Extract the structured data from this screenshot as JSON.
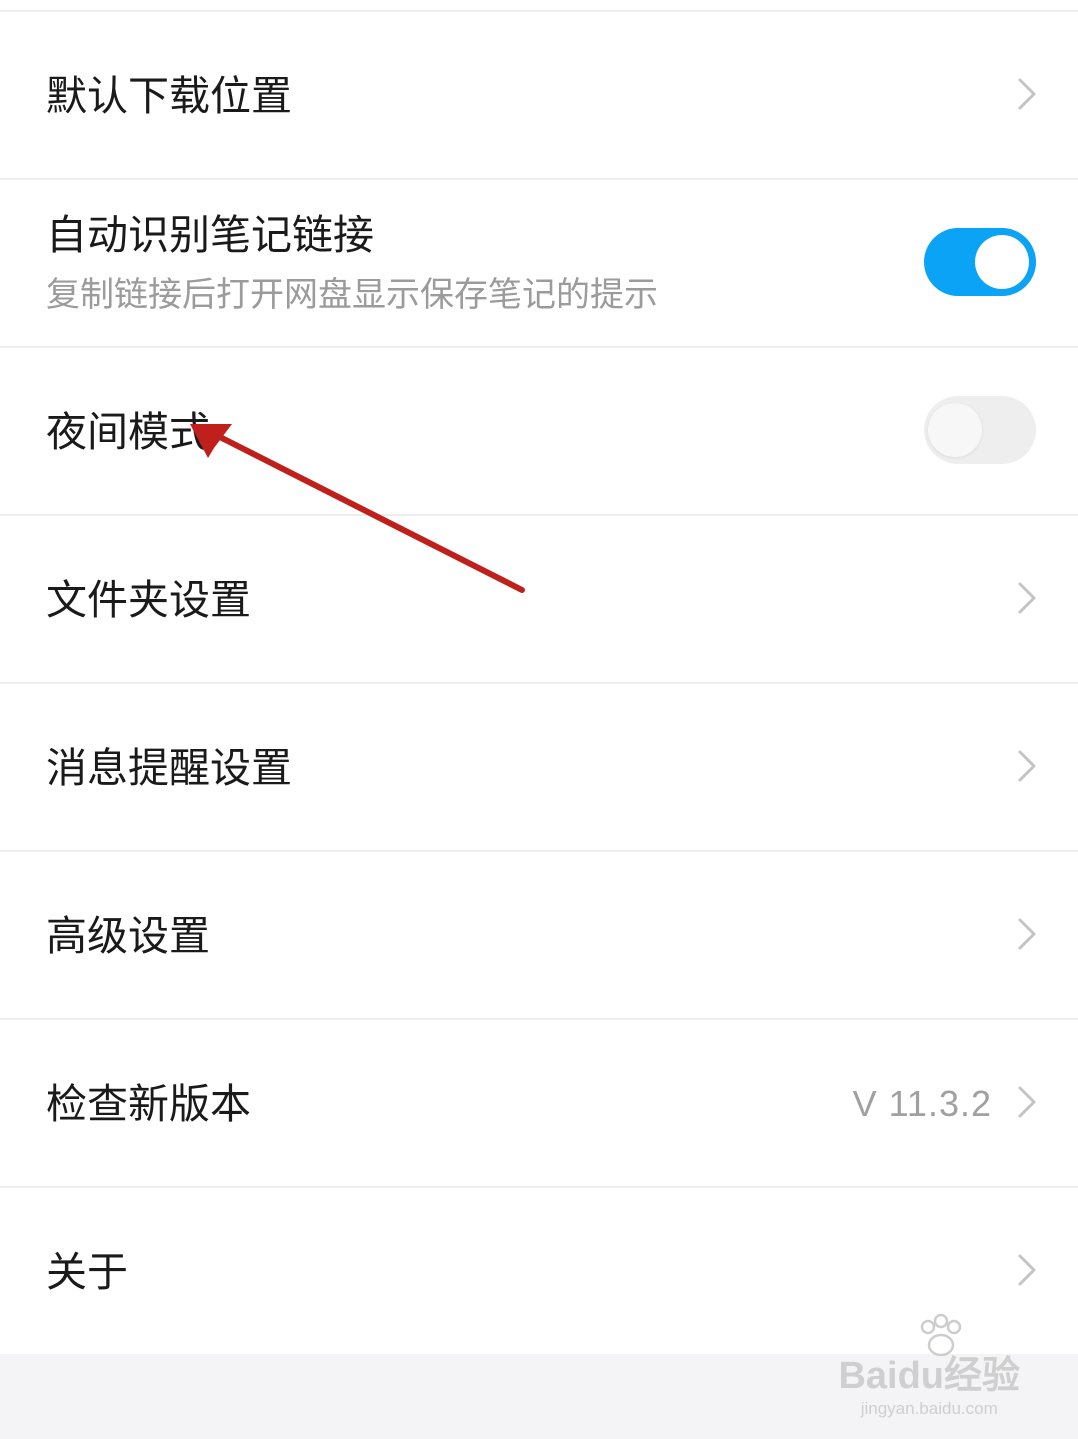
{
  "settings": {
    "rows": [
      {
        "title": "默认下载位置",
        "type": "link"
      },
      {
        "title": "自动识别笔记链接",
        "subtitle": "复制链接后打开网盘显示保存笔记的提示",
        "type": "toggle",
        "enabled": true
      },
      {
        "title": "夜间模式",
        "type": "toggle",
        "enabled": false
      },
      {
        "title": "文件夹设置",
        "type": "link"
      },
      {
        "title": "消息提醒设置",
        "type": "link"
      },
      {
        "title": "高级设置",
        "type": "link"
      },
      {
        "title": "检查新版本",
        "value": "V 11.3.2",
        "type": "link"
      },
      {
        "title": "关于",
        "type": "link"
      }
    ]
  },
  "icons": {
    "chevron": "chevron-right-icon"
  },
  "colors": {
    "toggle_on": "#0aa3f5",
    "toggle_off": "#eeeeee",
    "annotation_arrow": "#c0201c",
    "subtitle_text": "#9b9b9b"
  },
  "watermark": {
    "main": "Baidu经验",
    "sub": "jingyan.baidu.com"
  }
}
